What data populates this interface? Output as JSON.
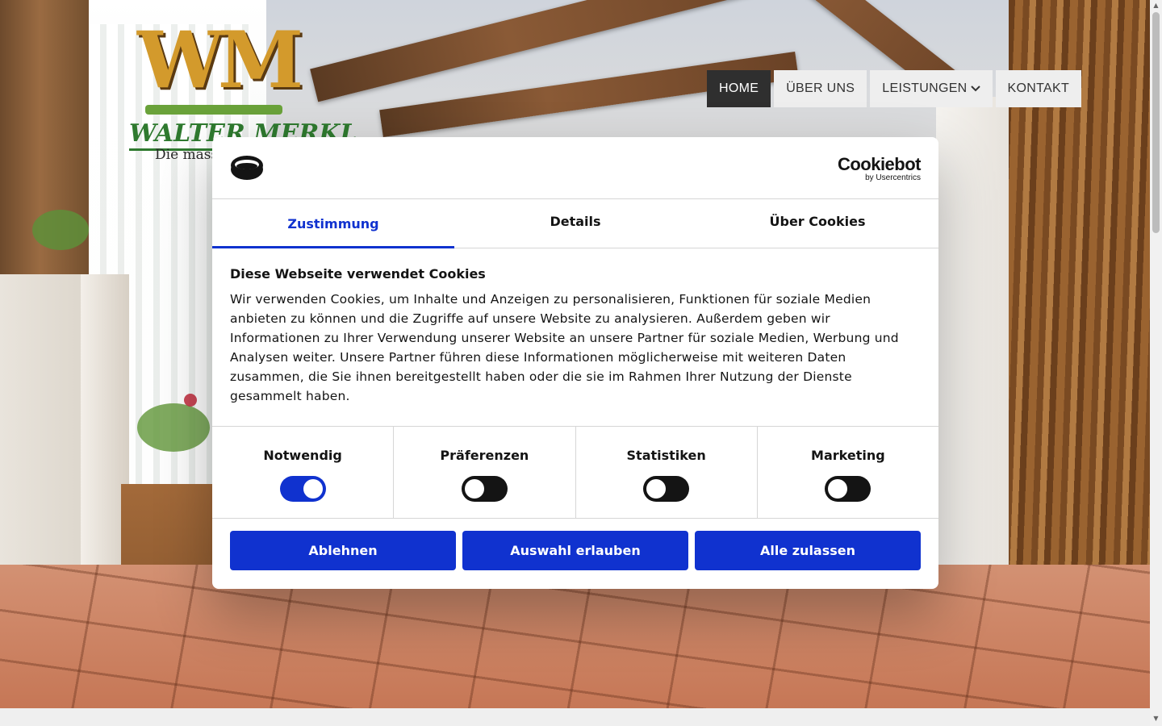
{
  "logo": {
    "mark": "WM",
    "name": "WALTER MERKL",
    "tagline": "Die mass"
  },
  "nav": {
    "items": [
      {
        "label": "HOME",
        "active": true
      },
      {
        "label": "ÜBER UNS",
        "active": false
      },
      {
        "label": "LEISTUNGEN",
        "active": false,
        "has_dropdown": true
      },
      {
        "label": "KONTAKT",
        "active": false
      }
    ]
  },
  "cookie_dialog": {
    "brand": "Cookiebot",
    "brand_sub": "by Usercentrics",
    "tabs": [
      {
        "label": "Zustimmung",
        "active": true
      },
      {
        "label": "Details",
        "active": false
      },
      {
        "label": "Über Cookies",
        "active": false
      }
    ],
    "heading": "Diese Webseite verwendet Cookies",
    "text": "Wir verwenden Cookies, um Inhalte und Anzeigen zu personalisieren, Funktionen für soziale Medien anbieten zu können und die Zugriffe auf unsere Website zu analysieren. Außerdem geben wir Informationen zu Ihrer Verwendung unserer Website an unsere Partner für soziale Medien, Werbung und Analysen weiter. Unsere Partner führen diese Informationen möglicherweise mit weiteren Daten zusammen, die Sie ihnen bereitgestellt haben oder die sie im Rahmen Ihrer Nutzung der Dienste gesammelt haben.",
    "categories": [
      {
        "label": "Notwendig",
        "enabled": true
      },
      {
        "label": "Präferenzen",
        "enabled": false
      },
      {
        "label": "Statistiken",
        "enabled": false
      },
      {
        "label": "Marketing",
        "enabled": false
      }
    ],
    "buttons": {
      "decline": "Ablehnen",
      "allow_selection": "Auswahl erlauben",
      "allow_all": "Alle zulassen"
    }
  },
  "colors": {
    "accent": "#1032cf",
    "nav_active_bg": "#2f2f2f",
    "nav_bg": "#eeeeee"
  }
}
